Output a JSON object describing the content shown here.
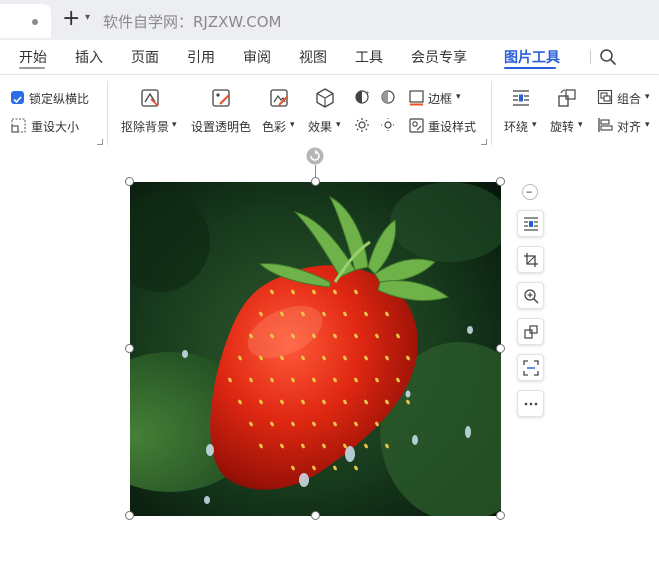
{
  "tabbar": {
    "address": "软件自学网：RJZXW.COM"
  },
  "menu": {
    "items": [
      "开始",
      "插入",
      "页面",
      "引用",
      "审阅",
      "视图",
      "工具",
      "会员专享",
      "图片工具"
    ],
    "active": "图片工具"
  },
  "ribbon": {
    "lock_ratio_label": "锁定纵横比",
    "lock_ratio_checked": true,
    "reset_size_label": "重设大小",
    "remove_bg_label": "抠除背景",
    "set_transparent_label": "设置透明色",
    "color_label": "色彩",
    "effects_label": "效果",
    "border_label": "边框",
    "reset_style_label": "重设样式",
    "wrap_label": "环绕",
    "rotate_label": "旋转",
    "group_label": "组合",
    "align_label": "对齐"
  },
  "side_toolbar": {
    "icons": [
      "wrap-layout-icon",
      "crop-icon",
      "zoom-in-icon",
      "rotate-copy-icon",
      "scan-icon",
      "more-icon"
    ]
  },
  "colors": {
    "accent": "#2b5fd9",
    "checkbox": "#2b6de8"
  }
}
